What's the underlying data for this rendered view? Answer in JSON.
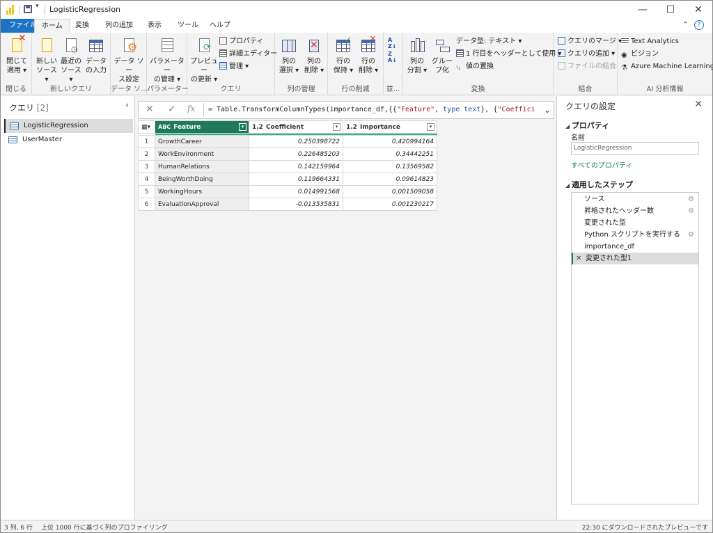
{
  "window": {
    "title": "LogisticRegression"
  },
  "menu": {
    "tabs": [
      "ファイル",
      "ホーム",
      "変換",
      "列の追加",
      "表示",
      "ツール",
      "ヘルプ"
    ]
  },
  "ribbon": {
    "close": {
      "btn1": "閉じて",
      "btn1b": "適用",
      "label": "閉じる"
    },
    "newquery": {
      "b1a": "新しい",
      "b1b": "ソース",
      "b2a": "最近の",
      "b2b": "ソース",
      "b3a": "データ",
      "b3b": "の入力",
      "label": "新しいクエリ"
    },
    "datasource": {
      "b1a": "データ ソー",
      "b1b": "ス設定",
      "label": "データ ソ..."
    },
    "params": {
      "b1a": "パラメーター",
      "b1b": "の管理",
      "label": "パラメーター"
    },
    "query": {
      "b1a": "プレビュー",
      "b1b": "の更新",
      "s1": "プロパティ",
      "s2": "詳細エディター",
      "s3": "管理",
      "label": "クエリ"
    },
    "cols": {
      "b1a": "列の",
      "b1b": "選択",
      "b2a": "列の",
      "b2b": "削除",
      "label": "列の管理"
    },
    "rows": {
      "b1a": "行の",
      "b1b": "保持",
      "b2a": "行の",
      "b2b": "削除",
      "label": "行の削減"
    },
    "sort": {
      "label": "並..."
    },
    "transform": {
      "b1a": "列の",
      "b1b": "分割",
      "b2a": "グルー",
      "b2b": "プ化",
      "s1": "データ型: テキスト",
      "s2": "1 行目をヘッダーとして使用",
      "s3": "値の置換",
      "label": "変換"
    },
    "combine": {
      "s1": "クエリのマージ",
      "s2": "クエリの追加",
      "s3": "ファイルの結合",
      "label": "結合"
    },
    "ai": {
      "s1": "Text Analytics",
      "s2": "ビジョン",
      "s3": "Azure Machine Learning",
      "label": "AI 分析情報"
    }
  },
  "queries": {
    "title": "クエリ",
    "count": "[2]",
    "items": [
      "LogisticRegression",
      "UserMaster"
    ]
  },
  "formula": {
    "fx": "fx",
    "prefix": "= Table.TransformColumnTypes(importance_df,{{",
    "s1": "\"Feature\"",
    "mid1": ", ",
    "k1": "type text",
    "mid2": "}, {",
    "s2": "\"Coefficient\"",
    "tail": ","
  },
  "table": {
    "columns": [
      {
        "type": "ABC",
        "name": "Feature"
      },
      {
        "type": "1.2",
        "name": "Coefficient"
      },
      {
        "type": "1.2",
        "name": "Importance"
      }
    ],
    "rows": [
      {
        "n": "1",
        "feature": "GrowthCareer",
        "coef": "0.250398722",
        "imp": "0.420994164"
      },
      {
        "n": "2",
        "feature": "WorkEnvironment",
        "coef": "0.226485203",
        "imp": "0.34442251"
      },
      {
        "n": "3",
        "feature": "HumanRelations",
        "coef": "0.142159964",
        "imp": "0.13569582"
      },
      {
        "n": "4",
        "feature": "BeingWorthDoing",
        "coef": "0.119664331",
        "imp": "0.09614823"
      },
      {
        "n": "5",
        "feature": "WorkingHours",
        "coef": "0.014991568",
        "imp": "0.001509058"
      },
      {
        "n": "6",
        "feature": "EvaluationApproval",
        "coef": "-0.013535831",
        "imp": "0.001230217"
      }
    ]
  },
  "settings": {
    "title": "クエリの設定",
    "properties": "プロパティ",
    "name_label": "名前",
    "name_value": "LogisticRegression",
    "all_props": "すべてのプロパティ",
    "steps_title": "適用したステップ",
    "steps": [
      "ソース",
      "昇格されたヘッダー数",
      "変更された型",
      "Python スクリプトを実行する",
      "importance_df",
      "変更された型1"
    ]
  },
  "status": {
    "left": "3 列, 6 行",
    "profiling": "上位 1000 行に基づく列のプロファイリング",
    "right": "22:30 にダウンロードされたプレビューです"
  },
  "colors": {
    "accent": "#1f7a5c",
    "file_tab": "#1f73c4",
    "logo": "#f2c811"
  }
}
